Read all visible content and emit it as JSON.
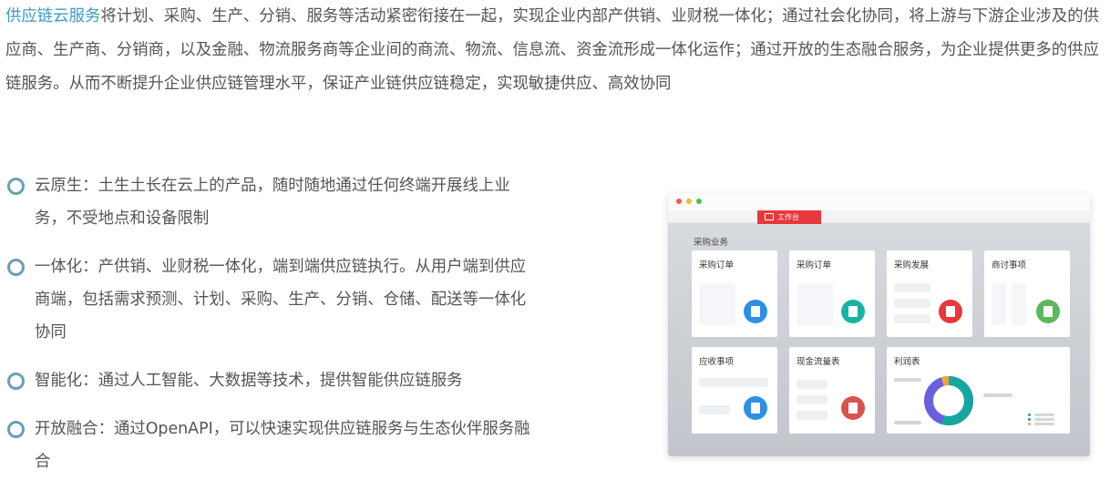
{
  "intro": {
    "highlight": "供应链云服务",
    "text": "将计划、采购、生产、分销、服务等活动紧密衔接在一起，实现企业内部产供销、业财税一体化；通过社会化协同，将上游与下游企业涉及的供应商、生产商、分销商，以及金融、物流服务商等企业间的商流、物流、信息流、资金流形成一体化运作；通过开放的生态融合服务，为企业提供更多的供应链服务。从而不断提升企业供应链管理水平，保证产业链供应链稳定，实现敏捷供应、高效协同"
  },
  "features": [
    {
      "text": "云原生：土生土长在云上的产品，随时随地通过任何终端开展线上业务，不受地点和设备限制"
    },
    {
      "text": "一体化：产供销、业财税一体化，端到端供应链执行。从用户端到供应商端，包括需求预测、计划、采购、生产、分销、仓储、配送等一体化协同"
    },
    {
      "text": "智能化：通过人工智能、大数据等技术，提供智能供应链服务"
    },
    {
      "text": "开放融合：通过OpenAPI，可以快速实现供应链服务与生态伙伴服务融合"
    }
  ],
  "mockup": {
    "tab_label": "工作台",
    "section_title": "采购业务",
    "cards": [
      {
        "title": "采购订单",
        "icon": "document-icon",
        "color": "#2e8fe6"
      },
      {
        "title": "采购订单",
        "icon": "home-icon",
        "color": "#16b3a4"
      },
      {
        "title": "采购发展",
        "icon": "pie-chart-icon",
        "color": "#e8383d"
      },
      {
        "title": "商讨事项",
        "icon": "chat-icon",
        "color": "#5cb85c"
      },
      {
        "title": "应收事项",
        "icon": "document-icon",
        "color": "#2e8fe6"
      },
      {
        "title": "现金流量表",
        "icon": "document-icon",
        "color": "#d9534f"
      },
      {
        "title": "利润表",
        "icon": "donut-chart-icon",
        "color": "#16a6a0"
      }
    ],
    "colors": {
      "accent_red": "#e8383d",
      "highlight_blue": "#3e9bc4",
      "donut_teal": "#16a6a0",
      "donut_purple": "#6b5fe0",
      "donut_orange": "#f0a33a"
    }
  }
}
